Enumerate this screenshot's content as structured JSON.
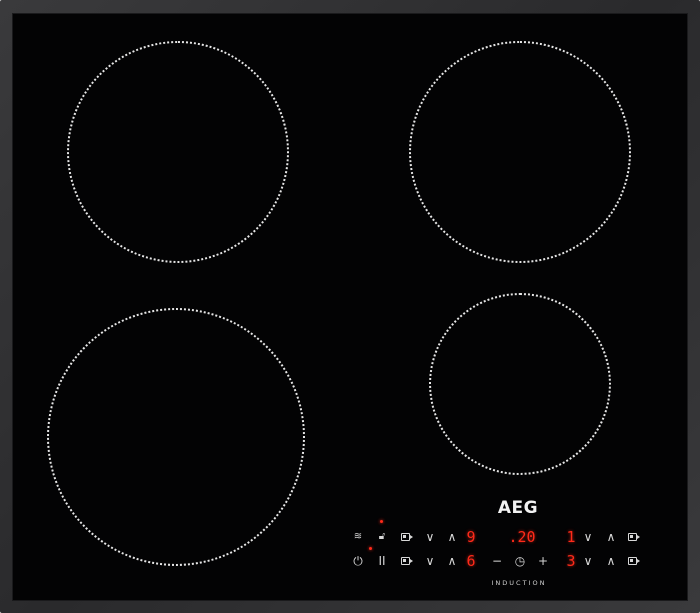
{
  "brand": {
    "logo": "AEG",
    "tagline": "INDUCTION"
  },
  "zones": [
    {
      "name": "rear-left"
    },
    {
      "name": "rear-right"
    },
    {
      "name": "front-left"
    },
    {
      "name": "front-right"
    }
  ],
  "controls": {
    "row1": {
      "bridge_icon": "bridge-icon",
      "lock_icon": "lock-icon",
      "left_zone_icon": "zone-select-icon",
      "left_down": "∨",
      "left_up": "∧",
      "left_display": "9",
      "timer_display": ".20",
      "right_display": "1",
      "right_down": "∨",
      "right_up": "∧",
      "right_zone_icon": "zone-select-icon"
    },
    "row2": {
      "power_icon": "power-icon",
      "pause_label": "II",
      "left_zone_icon": "zone-select-icon",
      "left_down": "∨",
      "left_up": "∧",
      "left_display": "6",
      "timer_minus": "−",
      "timer_icon": "timer-icon",
      "timer_plus": "+",
      "right_display": "3",
      "right_down": "∨",
      "right_up": "∧",
      "right_zone_icon": "zone-select-icon"
    }
  },
  "colors": {
    "glass": "#030304",
    "frame": "#333335",
    "zone_outline": "#e6e6e6",
    "display_red": "#ff2a1a",
    "control_symbol": "#d8d8d8"
  }
}
